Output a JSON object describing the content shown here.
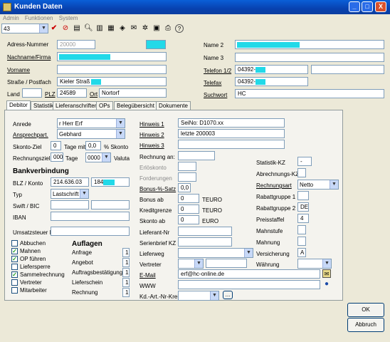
{
  "window": {
    "title": "Kunden Daten",
    "minimize": "_",
    "maximize": "□",
    "close": "X"
  },
  "menu": [
    "Admin",
    "Funktionen",
    "System"
  ],
  "toolbar": {
    "record_select": "43",
    "help": "?"
  },
  "address": {
    "adress_nummer_label": "Adress-Nummer",
    "adress_nummer": "20000",
    "nachname_label": "Nachname/Firma",
    "vorname_label": "Vorname",
    "strasse_label": "Straße / Postfach",
    "strasse": "Kieler Straß",
    "land_label": "Land",
    "plz_label": "PLZ",
    "plz": "24589",
    "ort_label": "Ort",
    "ort": "Nortorf",
    "name2_label": "Name 2",
    "name3_label": "Name 3",
    "telefon_label": "Telefon 1/2",
    "telefon": "04392-",
    "telefax_label": "Telefax",
    "telefax": "04392-",
    "suchwort_label": "Suchwort",
    "suchwort": "HC"
  },
  "tabs": [
    "Debitor",
    "Statistik",
    "Lieferanschriften",
    "OPs",
    "Belegübersicht",
    "Dokumente"
  ],
  "debitor": {
    "anrede_label": "Anrede",
    "anrede": "r Herr Erf",
    "ansprechpart_label": "Ansprechpart.",
    "ansprechpart": "Gebhard",
    "skonto_ziel_label": "Skonto-Ziel",
    "skonto_ziel": "0",
    "tage_mit_label": "Tage mit",
    "skonto_value": "0,0",
    "skonto_pct_label": "% Skonto",
    "rechnungsziel_label": "Rechnungsziel",
    "rechnungsziel": "000",
    "tage_label": "Tage",
    "valuta_value": "0000",
    "valuta_label": "Valuta",
    "bank_header": "Bankverbindung",
    "blz_label": "BLZ / Konto",
    "blz": "214.636.03",
    "konto": "184",
    "typ_label": "Typ",
    "typ": "Lastschrift",
    "swift_label": "Swift / BIC",
    "iban_label": "IBAN",
    "ust_label": "Umsatzsteuer ID",
    "checkboxes": [
      {
        "label": "Abbuchen",
        "checked": false
      },
      {
        "label": "Mahnen",
        "checked": true
      },
      {
        "label": "OP führen",
        "checked": true
      },
      {
        "label": "Liefersperre",
        "checked": false
      },
      {
        "label": "Sammelrechnung",
        "checked": true
      },
      {
        "label": "Vertreter",
        "checked": false
      },
      {
        "label": "Mitarbeiter",
        "checked": false
      }
    ],
    "check_mark": "✓",
    "auflagen_header": "Auflagen",
    "auflagen": [
      {
        "label": "Anfrage",
        "value": "1"
      },
      {
        "label": "Angebot",
        "value": "1"
      },
      {
        "label": "Auftragsbestätigung",
        "value": "1"
      },
      {
        "label": "Lieferschein",
        "value": "1"
      },
      {
        "label": "Rechnung",
        "value": "1"
      }
    ],
    "hinweis1_label": "Hinweis 1",
    "hinweis1": "SeiNo: D1070.xx",
    "hinweis2_label": "Hinweis 2",
    "hinweis2": "letzte 200003",
    "hinweis3_label": "Hinweis 3",
    "rechnung_an_label": "Rechnung an:",
    "erloeskonto_label": "Erlöskonto",
    "forderungen_label": "Forderungen",
    "bonus_satz_label": "Bonus-%-Satz",
    "bonus_satz": "0,0",
    "bonus_ab_label": "Bonus ab",
    "bonus_ab": "0",
    "bonus_ab_unit": "TEURO",
    "kreditgrenze_label": "Kreditgrenze",
    "kreditgrenze": "0",
    "kreditgrenze_unit": "TEURO",
    "skonto_ab_label": "Skonto ab",
    "skonto_ab": "0",
    "skonto_ab_unit": "EURO",
    "lieferant_nr_label": "Lieferant-Nr",
    "serienbrief_label": "Serienbrief KZ",
    "lieferweg_label": "Lieferweg",
    "vertreter_label": "Vertreter",
    "email_label": "E-Mail",
    "email": "erf@hc-online.de",
    "www_label": "WWW",
    "kdart_label": "Kd.-Art.-Nr-Kreis",
    "kdart_button": "...",
    "statistik_kz_label": "Statistik-KZ",
    "statistik_kz": "-",
    "abrechnungs_kz_label": "Abrechnungs-KZ",
    "rechnungsart_label": "Rechnungsart",
    "rechnungsart": "Netto",
    "rabatt1_label": "Rabattgruppe 1",
    "rabatt2_label": "Rabattgruppe 2",
    "rabatt2": "DE",
    "preisstaffel_label": "Preisstaffel",
    "preisstaffel": "4",
    "mahnstufe_label": "Mahnstufe",
    "mahnung_label": "Mahnung",
    "versicherung_label": "Versicherung",
    "versicherung": "A",
    "waehrung_label": "Währung"
  },
  "buttons": {
    "ok": "OK",
    "abbruch": "Abbruch"
  },
  "colors": {
    "titlebar": "#0a5fd8",
    "redacted": "#22d9e8",
    "panel": "#ece9d8"
  }
}
